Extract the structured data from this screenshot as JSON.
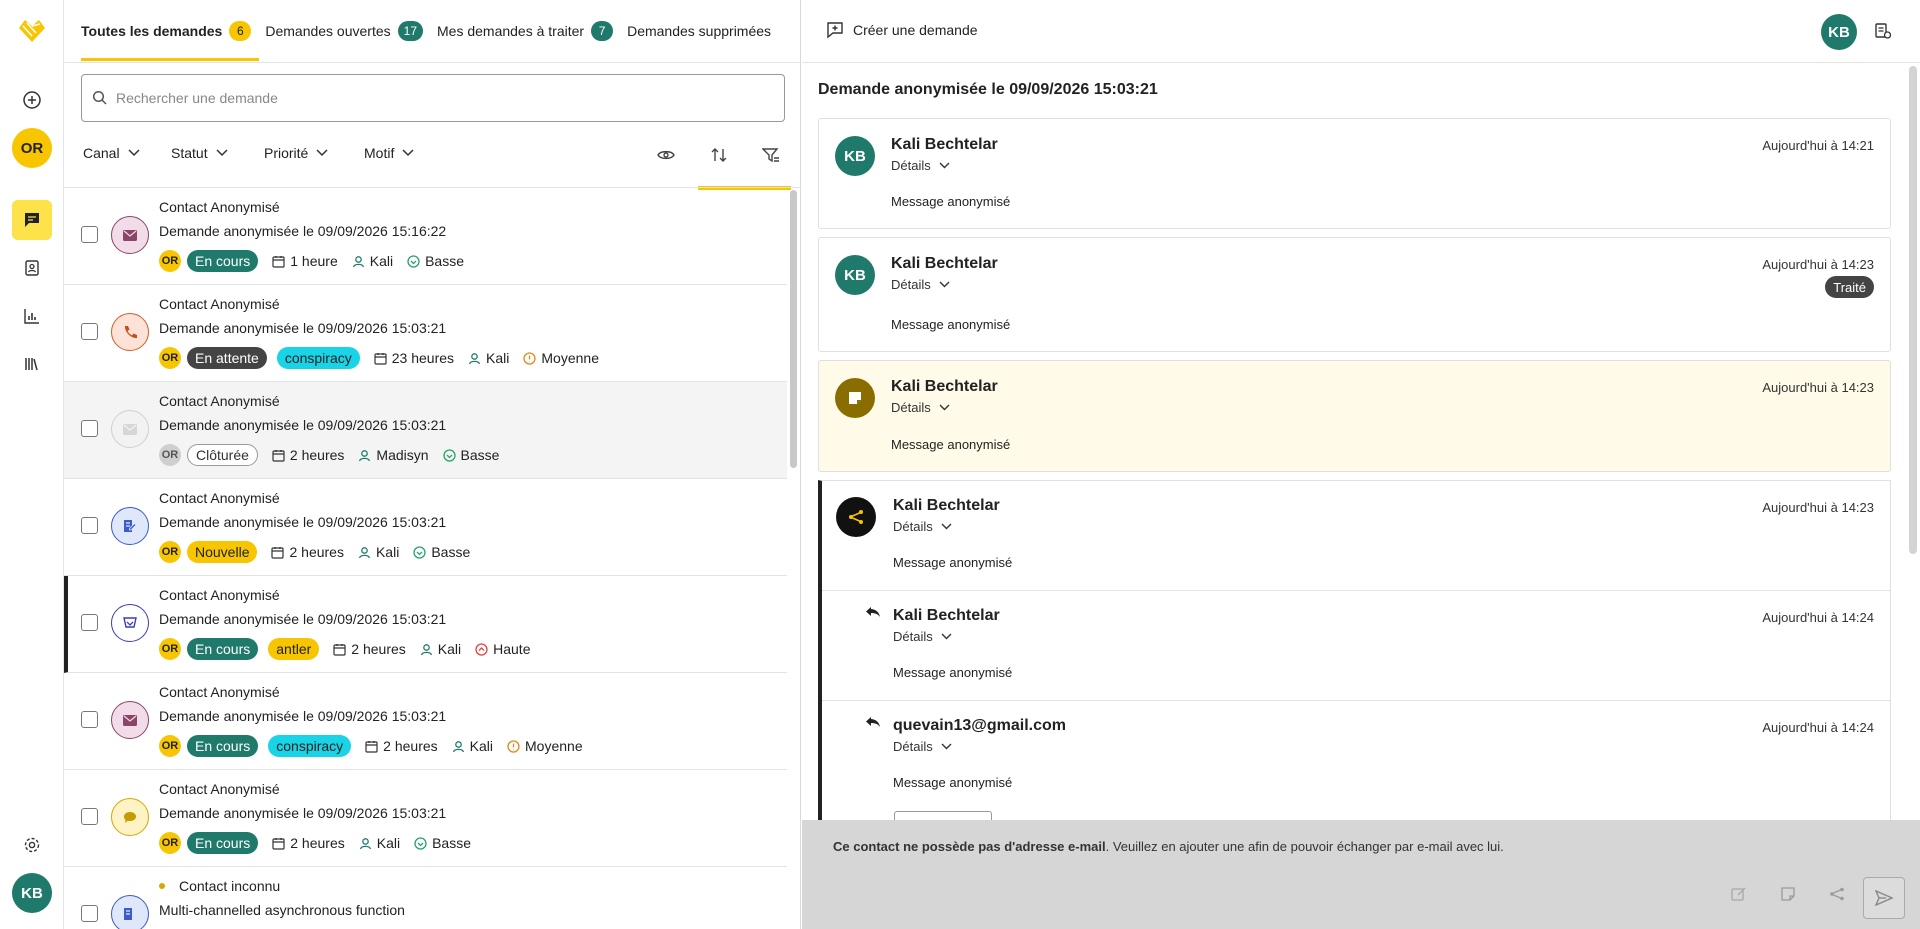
{
  "tabs": [
    {
      "label": "Toutes les demandes",
      "count": "6"
    },
    {
      "label": "Demandes ouvertes",
      "count": "17"
    },
    {
      "label": "Mes demandes à traiter",
      "count": "7"
    },
    {
      "label": "Demandes supprimées"
    }
  ],
  "rail": {
    "org_initials": "OR",
    "user_initials": "KB"
  },
  "search": {
    "placeholder": "Rechercher une demande"
  },
  "filters": [
    "Canal",
    "Statut",
    "Priorité",
    "Motif"
  ],
  "list": [
    {
      "contact": "Contact Anonymisé",
      "subject": "Demande anonymisée le 09/09/2026 15:16:22",
      "org": "OR",
      "status": "En cours",
      "tag": "",
      "age": "1 heure",
      "agent": "Kali",
      "priority": "Basse",
      "channel": "email"
    },
    {
      "contact": "Contact Anonymisé",
      "subject": "Demande anonymisée le 09/09/2026 15:03:21",
      "org": "OR",
      "status": "En attente",
      "tag": "conspiracy",
      "age": "23 heures",
      "agent": "Kali",
      "priority": "Moyenne",
      "channel": "phone"
    },
    {
      "contact": "Contact Anonymisé",
      "subject": "Demande anonymisée le 09/09/2026 15:03:21",
      "org": "OR",
      "status": "Clôturée",
      "tag": "",
      "age": "2 heures",
      "agent": "Madisyn",
      "priority": "Basse",
      "channel": "email-closed"
    },
    {
      "contact": "Contact Anonymisé",
      "subject": "Demande anonymisée le 09/09/2026 15:03:21",
      "org": "OR",
      "status": "Nouvelle",
      "tag": "",
      "age": "2 heures",
      "agent": "Kali",
      "priority": "Basse",
      "channel": "form"
    },
    {
      "contact": "Contact Anonymisé",
      "subject": "Demande anonymisée le 09/09/2026 15:03:21",
      "org": "OR",
      "status": "En cours",
      "tag": "antler",
      "age": "2 heures",
      "agent": "Kali",
      "priority": "Haute",
      "channel": "web"
    },
    {
      "contact": "Contact Anonymisé",
      "subject": "Demande anonymisée le 09/09/2026 15:03:21",
      "org": "OR",
      "status": "En cours",
      "tag": "conspiracy",
      "age": "2 heures",
      "agent": "Kali",
      "priority": "Moyenne",
      "channel": "email"
    },
    {
      "contact": "Contact Anonymisé",
      "subject": "Demande anonymisée le 09/09/2026 15:03:21",
      "org": "OR",
      "status": "En cours",
      "tag": "",
      "age": "2 heures",
      "agent": "Kali",
      "priority": "Basse",
      "channel": "chat"
    },
    {
      "contact": "Contact inconnu",
      "subject": "Multi-channelled asynchronous function",
      "channel": "form"
    }
  ],
  "detail": {
    "create_label": "Créer une demande",
    "user_initials": "KB",
    "title": "Demande anonymisée le 09/09/2026 15:03:21",
    "details_label": "Détails",
    "messages": [
      {
        "author": "Kali Bechtelar",
        "initials": "KB",
        "time": "Aujourd'hui à 14:21",
        "body": "Message anonymisé"
      },
      {
        "author": "Kali Bechtelar",
        "initials": "KB",
        "time": "Aujourd'hui à 14:23",
        "body": "Message anonymisé",
        "badge": "Traité"
      },
      {
        "author": "Kali Bechtelar",
        "time": "Aujourd'hui à 14:23",
        "body": "Message anonymisé"
      },
      {
        "author": "Kali Bechtelar",
        "time": "Aujourd'hui à 14:23",
        "body": "Message anonymisé"
      },
      {
        "author": "Kali Bechtelar",
        "time": "Aujourd'hui à 14:24",
        "body": "Message anonymisé"
      },
      {
        "author": "quevain13@gmail.com",
        "time": "Aujourd'hui à 14:24",
        "body": "Message anonymisé"
      }
    ],
    "footer_bold": "Ce contact ne possède pas d'adresse e-mail",
    "footer_rest": ". Veuillez en ajouter une afin de pouvoir échanger par e-mail avec lui."
  },
  "colors": {
    "accent": "#f7c600",
    "teal": "#1f7a6b",
    "cyan": "#19d3e6",
    "note": "#fffbe8"
  }
}
